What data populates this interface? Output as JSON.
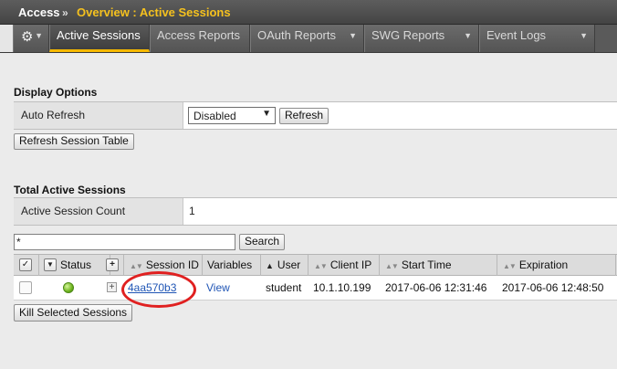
{
  "header": {
    "module": "Access",
    "separator": "»",
    "breadcrumb": "Overview : Active Sessions"
  },
  "tabs": {
    "gear": {
      "icon": "gear-icon",
      "caret": "▼"
    },
    "items": [
      {
        "label": "Active Sessions",
        "active": true,
        "has_menu": false
      },
      {
        "label": "Access Reports",
        "active": false,
        "has_menu": false
      },
      {
        "label": "OAuth Reports",
        "active": false,
        "has_menu": true
      },
      {
        "label": "SWG Reports",
        "active": false,
        "has_menu": true
      },
      {
        "label": "Event Logs",
        "active": false,
        "has_menu": true
      }
    ],
    "caret": "▼"
  },
  "display_options": {
    "title": "Display Options",
    "auto_refresh_label": "Auto Refresh",
    "auto_refresh_value": "Disabled",
    "caret": "▼",
    "refresh_button": "Refresh",
    "refresh_table_button": "Refresh Session Table"
  },
  "total_sessions": {
    "title": "Total Active Sessions",
    "count_label": "Active Session Count",
    "count_value": "1"
  },
  "filter": {
    "value": "*",
    "search_button": "Search"
  },
  "grid": {
    "headers": {
      "status": "Status",
      "session_id": "Session ID",
      "variables": "Variables",
      "user": "User",
      "client_ip": "Client IP",
      "start_time": "Start Time",
      "expiration": "Expiration"
    },
    "header_glyphs": {
      "check": "✓",
      "dropdown": "▼",
      "expand": "+",
      "sort_both": "▲▼",
      "sort_up": "▲"
    },
    "rows": [
      {
        "status": "active",
        "expand": "+",
        "session_id": "4aa570b3",
        "variables": "View",
        "user": "student",
        "client_ip": "10.1.10.199",
        "start_time": "2017-06-06 12:31:46",
        "expiration": "2017-06-06 12:48:50"
      }
    ]
  },
  "actions": {
    "kill_button": "Kill Selected Sessions"
  },
  "colors": {
    "accent": "#f5b800",
    "breadcrumb": "#f5c11e",
    "link": "#1f55b5",
    "status_ok": "#6fb51f",
    "annotation": "#e02020"
  }
}
